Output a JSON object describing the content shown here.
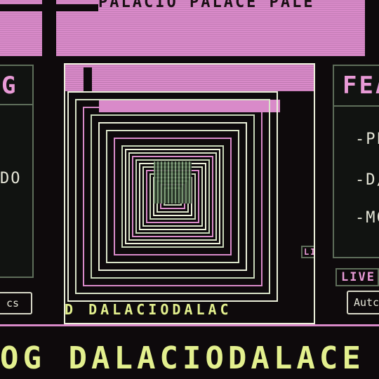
{
  "banner": {
    "text": "PALACIO PALACE PALE"
  },
  "left_panel": {
    "title": "G",
    "item": "DO",
    "button": "cs"
  },
  "right_panel": {
    "title": "FEA",
    "items": [
      "-PL",
      "-D/",
      "-MC"
    ],
    "small_tag": "LIV",
    "live_tag": "LIVE",
    "button": "Autc"
  },
  "window": {
    "caption": "D DALACIODALAC"
  },
  "marquee": {
    "text": "OG DALACIODALACE"
  },
  "colors": {
    "pink": "#d98ac9",
    "lime": "#e3f08e",
    "frame": "#5e6e5a",
    "bg": "#0e0a0c"
  }
}
